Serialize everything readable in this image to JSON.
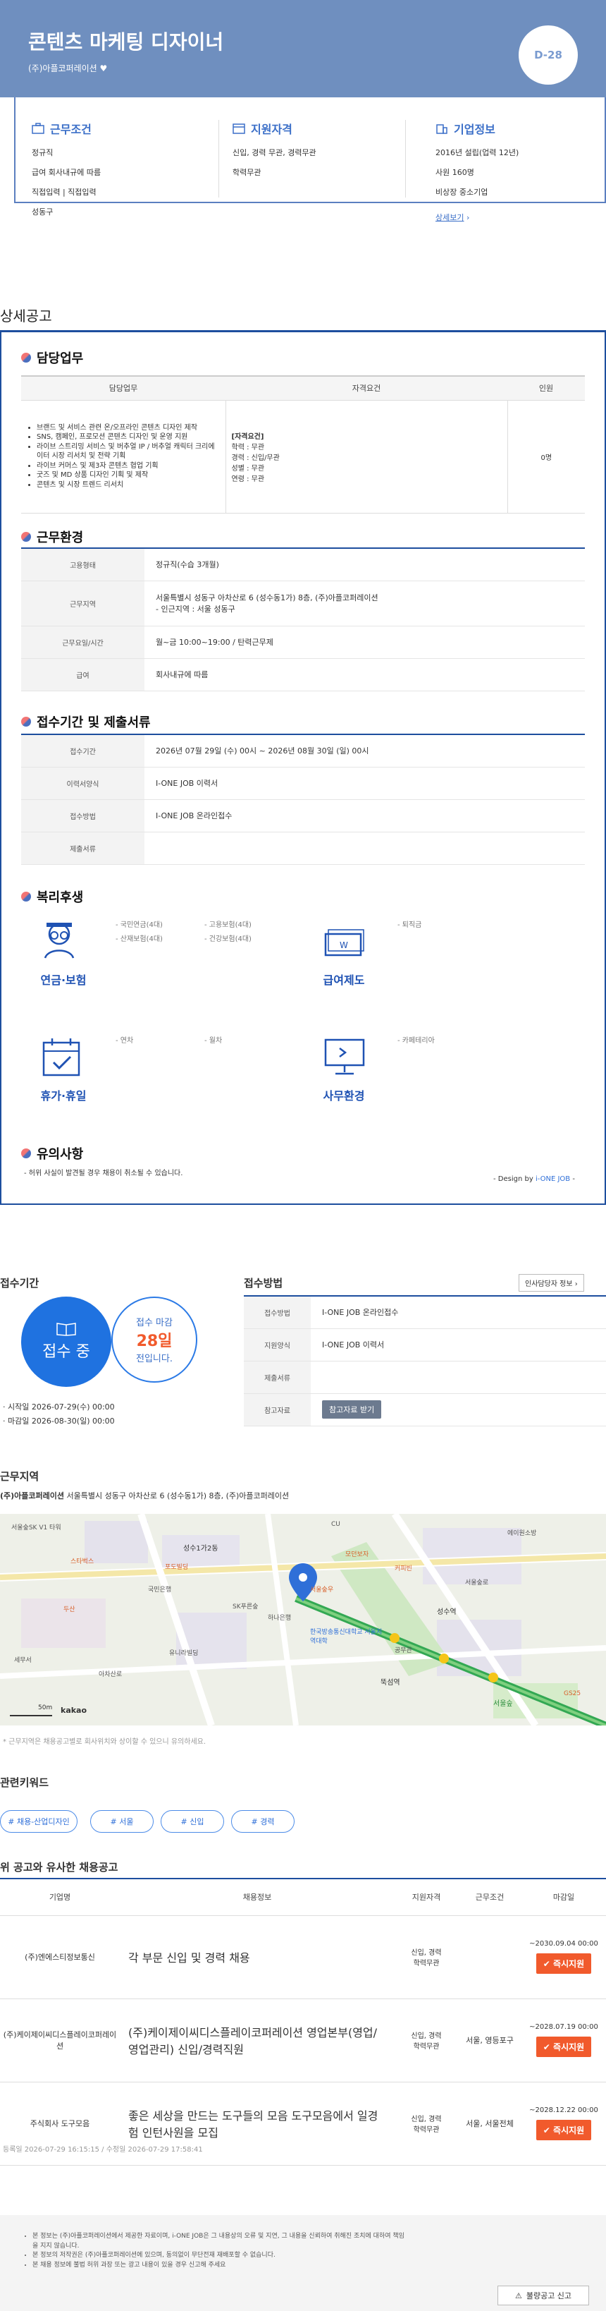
{
  "header": {
    "title": "콘텐츠 마케팅 디자이너",
    "company": "(주)아플코퍼레이션",
    "heart": "♥",
    "dday": "D-28"
  },
  "summary": {
    "conditions": {
      "title": "근무조건",
      "lines": [
        "정규직",
        "급여 회사내규에 따름",
        "직접입력 | 직접입력",
        "성동구"
      ]
    },
    "qualification": {
      "title": "지원자격",
      "lines": [
        "신입, 경력 무관, 경력무관",
        "학력무관"
      ]
    },
    "company": {
      "title": "기업정보",
      "lines": [
        "2016년 설립(업력 12년)",
        "사원 160명",
        "비상장 중소기업"
      ],
      "more": "상세보기"
    }
  },
  "detail": {
    "title": "상세공고"
  },
  "duty": {
    "title": "담당업무",
    "headers": [
      "담당업무",
      "자격요건",
      "인원"
    ],
    "duties": [
      "브랜드 및 서비스 관련 온/오프라인 콘텐츠 디자인 제작",
      "SNS, 캠페인, 프로모션 콘텐츠 디자인 및 운영 지원",
      "라이브 스트리밍 서비스 및 버추얼 IP / 버추얼 캐릭터 크리에이터 시장 리서치 및 전략 기획",
      "라이브 커머스 및 제3자 콘텐츠 협업 기획",
      "굿즈 및 MD 상품 디자인 기획 및 제작",
      "콘텐츠 및 시장 트렌드 리서치"
    ],
    "qual_head": "[자격요건]",
    "quals": [
      "학력 : 무관",
      "경력 : 신입/무관",
      "성별 : 무관",
      "연령 : 무관"
    ],
    "count": "0명"
  },
  "environment": {
    "title": "근무환경",
    "rows": [
      {
        "label": "고용형태",
        "value": "정규직(수습 3개월)"
      },
      {
        "label": "근무지역",
        "value": "서울특별시 성동구 아차산로 6 (성수동1가) 8층, (주)아플코퍼레이션",
        "value2": "- 인근지역 : 서울 성동구"
      },
      {
        "label": "근무요일/시간",
        "value": "월~금 10:00~19:00 / 탄력근무제"
      },
      {
        "label": "급여",
        "value": "회사내규에 따름"
      }
    ]
  },
  "receipt": {
    "title": "접수기간 및 제출서류",
    "rows": [
      {
        "label": "접수기간",
        "value": "2026년 07월 29일 (수) 00시 ~ 2026년 08월 30일 (일) 00시"
      },
      {
        "label": "이력서양식",
        "value": "I-ONE JOB 이력서"
      },
      {
        "label": "접수방법",
        "value": "I-ONE JOB 온라인접수"
      },
      {
        "label": "제출서류",
        "value": ""
      }
    ]
  },
  "welfare": {
    "title": "복리후생",
    "groups": [
      {
        "name": "연금·보험",
        "items": [
          "- 국민연금(4대)",
          "- 고용보험(4대)",
          "- 산재보험(4대)",
          "- 건강보험(4대)"
        ]
      },
      {
        "name": "급여제도",
        "items": [
          "- 퇴직금"
        ]
      },
      {
        "name": "휴가·휴일",
        "items": [
          "- 연차",
          "- 월차"
        ]
      },
      {
        "name": "사무환경",
        "items": [
          "- 카페테리아"
        ]
      }
    ]
  },
  "caution": {
    "title": "유의사항",
    "text": "- 허위 사실이 발견될 경우 채용이 취소될 수 있습니다.",
    "design_prefix": "- Design by ",
    "design_brand": "i-ONE JOB",
    "design_suffix": " -"
  },
  "period": {
    "title": "접수기간",
    "status": "접수 중",
    "deadline_label": "접수 마감",
    "days": "28일",
    "days_suffix": "전입니다.",
    "start": "· 시작일 2026-07-29(수) 00:00",
    "end": "· 마감일 2026-08-30(일) 00:00"
  },
  "method": {
    "title": "접수방법",
    "contact_btn": "인사담당자 정보",
    "rows": [
      {
        "label": "접수방법",
        "value": "I-ONE JOB 온라인접수"
      },
      {
        "label": "지원양식",
        "value": "I-ONE JOB 이력서"
      },
      {
        "label": "제출서류",
        "value": ""
      },
      {
        "label": "참고자료",
        "value": "참고자료 받기"
      }
    ]
  },
  "location": {
    "title": "근무지역",
    "tag": "(주)아플코퍼레이션",
    "address": "서울특별시 성동구 아차산로 6 (성수동1가) 8층, (주)아플코퍼레이션",
    "note": "* 근무지역은 채용공고별로 회사위치와 상이할 수 있으니 유의하세요.",
    "scale": "50m",
    "map_brand": "kakao"
  },
  "map_labels": [
    "서울숲SK V1 타워",
    "성수1가2동",
    "포도빌딩",
    "국민은행",
    "SK푸른숲",
    "두산",
    "성수역",
    "서울숲우",
    "모던보자",
    "한국방송통신대학교 서울지역대학",
    "공무관",
    "서울숲",
    "뚝섬역",
    "커피빈",
    "CU",
    "스타벅스",
    "서울숲로",
    "아차산로",
    "에이원소방",
    "하나은행",
    "GS25",
    "세무서",
    "유니라빌딩"
  ],
  "keywords": {
    "title": "관련키워드",
    "items": [
      "# 채용-산업디자인",
      "# 서울",
      "# 신입",
      "# 경력"
    ]
  },
  "similar": {
    "title": "위 공고와 유사한 채용공고",
    "headers": [
      "기업명",
      "채용정보",
      "지원자격",
      "근무조건",
      "마감일"
    ],
    "rows": [
      {
        "company": "(주)엔에스티정보통신",
        "title": "각 부문 신입 및 경력 채용",
        "qual": "신입, 경력\n학력무관",
        "cond": "",
        "deadline": "~2030.09.04 00:00",
        "btn": "즉시지원"
      },
      {
        "company": "(주)케이제이씨디스플레이코퍼레이션",
        "title": "(주)케이제이씨디스플레이코퍼레이션 영업본부(영업/영업관리) 신입/경력직원",
        "qual": "신입, 경력\n학력무관",
        "cond": "서울, 영등포구",
        "deadline": "~2028.07.19 00:00",
        "btn": "즉시지원"
      },
      {
        "company": "주식회사 도구모음",
        "title": "좋은 세상을 만드는 도구들의 모음 도구모음에서 일경험 인턴사원을 모집",
        "qual": "신입, 경력\n학력무관",
        "cond": "서울, 서울전체",
        "deadline": "~2028.12.22 00:00",
        "btn": "즉시지원"
      }
    ]
  },
  "dates": "등록일 2026-07-29 16:15:15 / 수정일 2026-07-29 17:58:41",
  "notice": {
    "lines": [
      "본 정보는 (주)아플코퍼레이션에서 제공한 자료이며, i-ONE JOB은 그 내용상의 오류 및 지연, 그 내용을 신뢰하여 취해진 조치에 대하여 책임을 지지 않습니다.",
      "본 정보의 저작권은 (주)아플코퍼레이션에 있으며, 동의없이 무단전재 재배포할 수 없습니다.",
      "본 채용 정보에 불법 허위 과장 또는 광고 내용이 있을 경우 신고해 주세요"
    ],
    "report": "불량공고 신고"
  }
}
